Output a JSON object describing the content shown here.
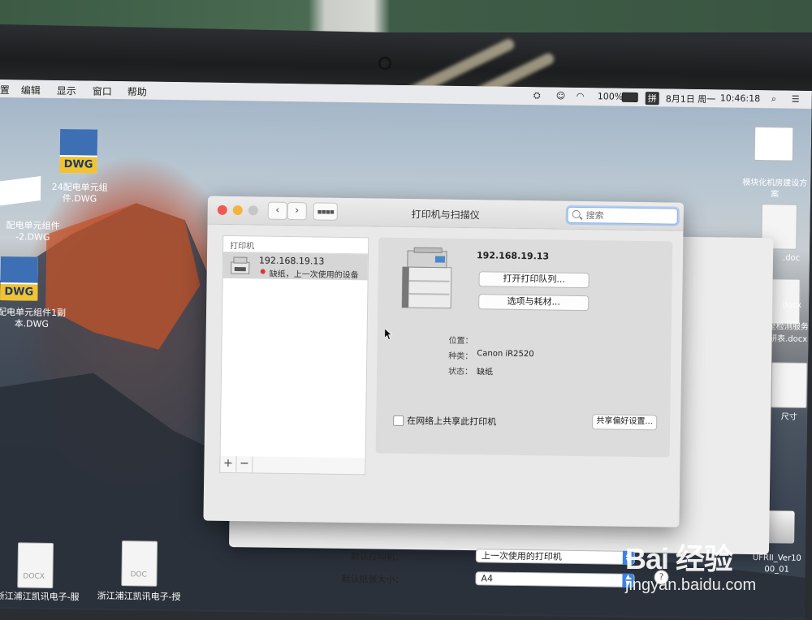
{
  "menubar": {
    "items": [
      "置",
      "编辑",
      "显示",
      "窗口",
      "帮助"
    ],
    "battery": "100%",
    "input_method": "拼",
    "date": "8月1日 周一",
    "time": "10:46:18"
  },
  "desktop": {
    "icons": [
      {
        "label_line1": "24配电单元组",
        "label_line2": "件.DWG",
        "type": "DWG"
      },
      {
        "label_line1": "配电单元组件",
        "label_line2": "-2.DWG",
        "type": "generic"
      },
      {
        "label_line1": "配电单元组件1副",
        "label_line2": "本.DWG",
        "type": "DWG"
      },
      {
        "label_line1": "浙江浦江凯讯电子-服",
        "label_line2": "",
        "type": "DOCX"
      },
      {
        "label_line1": "浙江浦江凯讯电子-授",
        "label_line2": "",
        "type": "DOC"
      }
    ],
    "right_labels": [
      "模块化机房建设方案",
      ".doc",
      "docx",
      "全检测服务",
      "研表.docx",
      "尺寸",
      "UFRII_Ver10",
      "00_01"
    ],
    "icon_type_labels": {
      "dwg": "DWG",
      "docx": "DOCX",
      "doc": "DOC"
    }
  },
  "window": {
    "title": "打印机与扫描仪",
    "search_placeholder": "搜索",
    "nav_back": "‹",
    "nav_forward": "›",
    "grid_icon": "grid-icon",
    "printer_list_header": "打印机",
    "printers": [
      {
        "name": "192.168.19.13",
        "status": "缺纸，上一次使用的设备",
        "status_color": "#dd3333"
      }
    ],
    "add_button": "+",
    "remove_button": "−",
    "detail": {
      "name": "192.168.19.13",
      "open_queue_button": "打开打印队列...",
      "options_button": "选项与耗材...",
      "location_label": "位置：",
      "location_value": "",
      "kind_label": "种类：",
      "kind_value": "Canon iR2520",
      "status_label": "状态：",
      "status_value": "缺纸",
      "share_checkbox_label": "在网络上共享此打印机",
      "share_checked": false,
      "share_prefs_button": "共享偏好设置..."
    },
    "default_printer_label": "默认打印机：",
    "default_printer_value": "上一次使用的打印机",
    "default_paper_label": "默认纸张大小：",
    "default_paper_value": "A4",
    "help_button": "?"
  },
  "watermark": {
    "logo": "Bai 经验",
    "url": "jingyan.baidu.com"
  },
  "colors": {
    "select_arrow": "#3b82e8",
    "close": "#ee5a52",
    "minimize": "#f4b43c",
    "zoom": "#c6c6c6"
  }
}
